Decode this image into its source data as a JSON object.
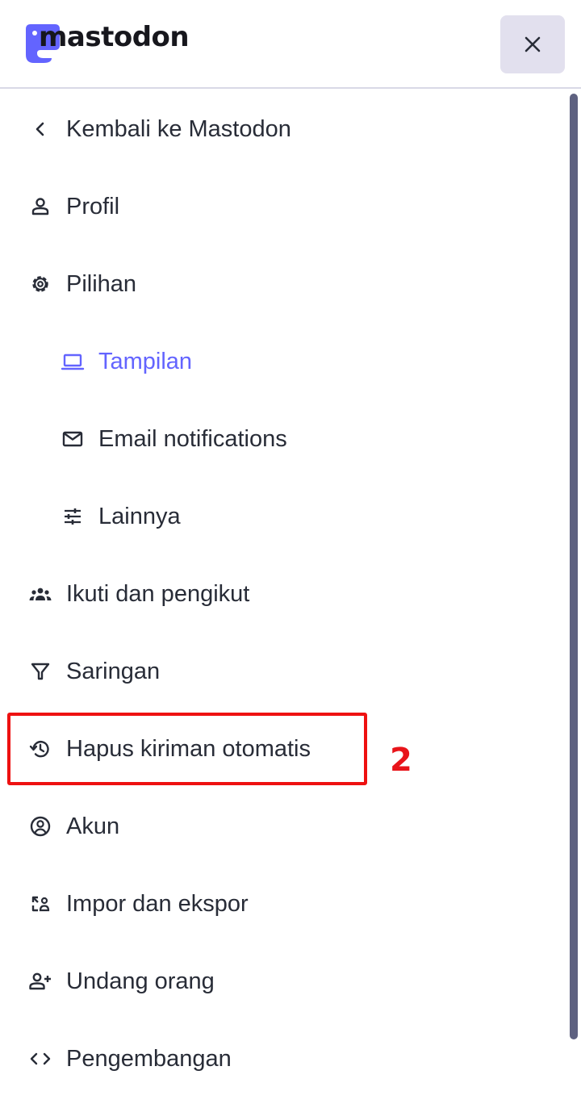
{
  "header": {
    "logo_text": "mastodon",
    "close_icon": "close-icon",
    "accent_color": "#6364ff"
  },
  "nav": {
    "items": [
      {
        "label": "Kembali ke Mastodon",
        "icon": "chevron-left-icon"
      },
      {
        "label": "Profil",
        "icon": "person-icon"
      },
      {
        "label": "Pilihan",
        "icon": "gear-icon"
      },
      {
        "label": "Tampilan",
        "icon": "laptop-icon",
        "active": true
      },
      {
        "label": "Email notifications",
        "icon": "mail-icon"
      },
      {
        "label": "Lainnya",
        "icon": "sliders-icon"
      },
      {
        "label": "Ikuti dan pengikut",
        "icon": "group-icon"
      },
      {
        "label": "Saringan",
        "icon": "filter-icon"
      },
      {
        "label": "Hapus kiriman otomatis",
        "icon": "history-icon"
      },
      {
        "label": "Akun",
        "icon": "account-circle-icon"
      },
      {
        "label": "Impor dan ekspor",
        "icon": "import-export-icon"
      },
      {
        "label": "Undang orang",
        "icon": "person-add-icon"
      },
      {
        "label": "Pengembangan",
        "icon": "code-icon"
      }
    ]
  },
  "annotation": {
    "step_number": "2",
    "highlight_color": "#ee1111"
  }
}
